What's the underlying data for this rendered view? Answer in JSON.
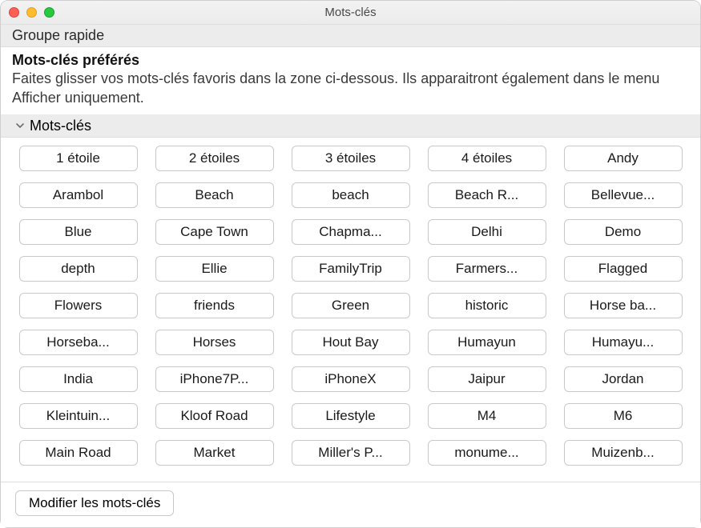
{
  "window": {
    "title": "Mots-clés"
  },
  "sections": {
    "quick_group": "Groupe rapide",
    "preferred_title": "Mots-clés préférés",
    "preferred_desc": "Faites glisser vos mots-clés favoris dans la zone ci-dessous. Ils apparaitront également dans le menu Afficher uniquement.",
    "keywords_label": "Mots-clés"
  },
  "keywords": [
    "1 étoile",
    "2 étoiles",
    "3 étoiles",
    "4 étoiles",
    "Andy",
    "Arambol",
    "Beach",
    "beach",
    "Beach R...",
    "Bellevue...",
    "Blue",
    "Cape Town",
    "Chapma...",
    "Delhi",
    "Demo",
    "depth",
    "Ellie",
    "FamilyTrip",
    "Farmers...",
    "Flagged",
    "Flowers",
    "friends",
    "Green",
    "historic",
    "Horse ba...",
    "Horseba...",
    "Horses",
    "Hout Bay",
    "Humayun",
    "Humayu...",
    "India",
    "iPhone7P...",
    "iPhoneX",
    "Jaipur",
    "Jordan",
    "Kleintuin...",
    "Kloof Road",
    "Lifestyle",
    "M4",
    "M6",
    "Main Road",
    "Market",
    "Miller's P...",
    "monume...",
    "Muizenb..."
  ],
  "footer": {
    "edit_label": "Modifier les mots-clés"
  }
}
